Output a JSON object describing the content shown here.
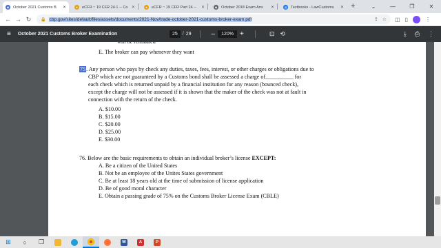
{
  "browser": {
    "tabs": [
      {
        "title": "October 2021 Customs B",
        "icon": "document-icon",
        "color": "#4a6fd1",
        "active": true
      },
      {
        "title": "eCFR :: 19 CFR 24.1 -- Co",
        "icon": "ecfr-icon",
        "color": "#e8a317",
        "active": false
      },
      {
        "title": "eCFR :: 19 CFR Part 24 --",
        "icon": "ecfr-icon",
        "color": "#e8a317",
        "active": false
      },
      {
        "title": "October 2018 Exam Ans",
        "icon": "document-icon",
        "color": "#5f6368",
        "active": false
      },
      {
        "title": "Textbooks - LawCustoms",
        "icon": "book-icon",
        "color": "#1a73e8",
        "active": false
      }
    ],
    "url_highlight": "cbp.gov/sites/default/files/assets/documents/2021-Nov/trade-october-2021-customs-broker-exam.pdf"
  },
  "pdf_toolbar": {
    "title": "October 2021 Customs Broker Examination",
    "current_page": "25",
    "separator": "/",
    "total_pages": "29",
    "zoom_minus": "–",
    "zoom": "120%",
    "zoom_plus": "+"
  },
  "document": {
    "prev_choice_cut": "will be reinstated",
    "prev_choice_e": "E.   The broker can pay whenever they want",
    "q75": {
      "number": "75",
      "lines": [
        ". Any person who pays by check any duties, taxes, fees, interest, or other charges or obligations due to",
        "CBP which are not guaranteed by a Customs bond shall be assessed a charge of__________ for",
        "each check which is returned unpaid by a financial institution for any reason (bounced check),",
        "except the charge will not be assessed if it is shown that the maker of the check was not at fault in",
        "connection with the return of the check."
      ],
      "choices": [
        "A.   $10.00",
        "B.   $15.00",
        "C.   $20.00",
        "D.   $25.00",
        "E.   $30.00"
      ]
    },
    "q76": {
      "stem": "76. Below are the basic requirements to obtain an individual broker’s license ",
      "stem_bold": "EXCEPT:",
      "choices": [
        "A.   Be a citizen of the United States",
        "B.   Not be an employee of the Unites States government",
        "C.   Be at least 18 years old at the time of submission of license application",
        "D.   Be of good moral character",
        "E.   Obtain a passing grade of 75% on the Customs Broker License Exam (CBLE)"
      ]
    }
  },
  "taskbar": {
    "apps": [
      "windows-start-icon",
      "search-icon",
      "task-view-icon",
      "file-explorer-icon",
      "edge-icon",
      "chrome-icon",
      "firefox-icon",
      "word-icon",
      "acrobat-icon",
      "powerpoint-icon"
    ]
  }
}
